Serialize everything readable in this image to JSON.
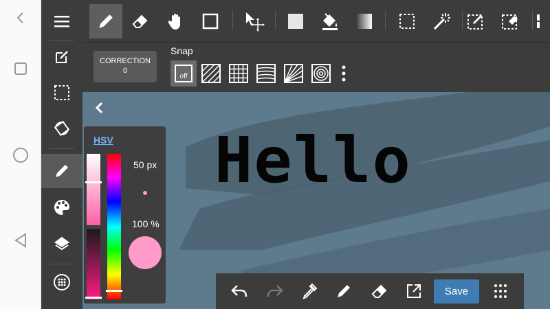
{
  "correction": {
    "label": "CORRECTION",
    "value": "0"
  },
  "snap": {
    "label": "Snap",
    "off_label": "off"
  },
  "canvas": {
    "text": "Hello"
  },
  "color_panel": {
    "mode": "HSV",
    "size": "50 px",
    "opacity": "100 %",
    "color": "#ff9ac9"
  },
  "bottom_bar": {
    "save_label": "Save"
  },
  "top_toolbar": {
    "tools": [
      "pen-icon",
      "eraser-icon",
      "hand-icon",
      "square-icon",
      "move-icon",
      "fill-rect-icon",
      "bucket-icon",
      "gradient-icon",
      "select-rect-icon",
      "magic-wand-icon",
      "select-pen-icon",
      "select-eraser-icon"
    ]
  },
  "left_toolbar": {
    "tools": [
      "menu-icon",
      "edit-icon",
      "selection-icon",
      "rotate-icon",
      "brush-icon",
      "palette-icon",
      "layers-icon",
      "material-icon"
    ]
  },
  "colors": {
    "accent": "#3f7cb3",
    "canvas_bg": "#5d7b8c",
    "toolbar_bg": "#3c3c3c"
  }
}
